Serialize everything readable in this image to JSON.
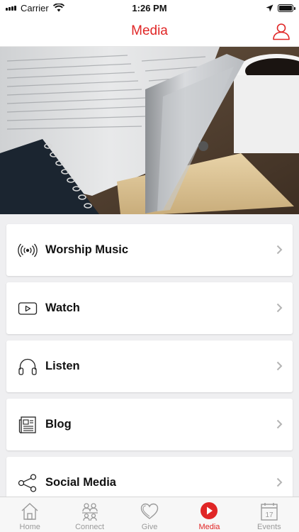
{
  "status_bar": {
    "carrier": "Carrier",
    "time": "1:26 PM"
  },
  "header": {
    "title": "Media"
  },
  "menu": {
    "items": [
      {
        "label": "Worship Music",
        "icon": "broadcast-icon"
      },
      {
        "label": "Watch",
        "icon": "youtube-play-icon"
      },
      {
        "label": "Listen",
        "icon": "headphones-icon"
      },
      {
        "label": "Blog",
        "icon": "newspaper-icon"
      },
      {
        "label": "Social Media",
        "icon": "share-icon"
      }
    ]
  },
  "tabbar": {
    "tabs": [
      {
        "label": "Home",
        "icon": "home-icon"
      },
      {
        "label": "Connect",
        "icon": "people-icon"
      },
      {
        "label": "Give",
        "icon": "heart-icon"
      },
      {
        "label": "Media",
        "icon": "play-circle-icon",
        "active": true
      },
      {
        "label": "Events",
        "icon": "calendar-icon",
        "date": "17"
      }
    ]
  },
  "colors": {
    "accent": "#e02626",
    "inactive": "#9a9a9a"
  }
}
